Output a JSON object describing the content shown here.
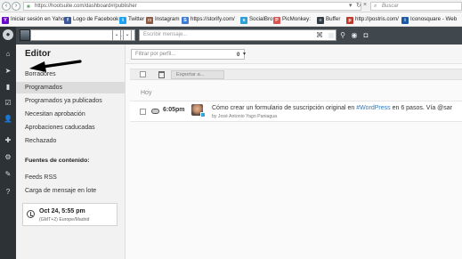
{
  "browser": {
    "url": "https://hootsuite.com/dashboard#/publisher",
    "search_placeholder": "Buscar"
  },
  "bookmarks": [
    {
      "label": "Iniciar sesión en Yahoo",
      "icon": "yahoo-icon",
      "color": "#6b0ac9"
    },
    {
      "label": "Logo de Facebook",
      "icon": "facebook-icon",
      "color": "#3b5998"
    },
    {
      "label": "Twitter",
      "icon": "twitter-icon",
      "color": "#1da1f2"
    },
    {
      "label": "Instagram",
      "icon": "instagram-icon",
      "color": "#8a5a44"
    },
    {
      "label": "https://storify.com/",
      "icon": "storify-icon",
      "color": "#3a7bd5"
    },
    {
      "label": "SocialBro",
      "icon": "socialbro-icon",
      "color": "#2f9fd8"
    },
    {
      "label": "PicMonkey:",
      "icon": "picmonkey-icon",
      "color": "#d9534f"
    },
    {
      "label": "Buffer",
      "icon": "buffer-icon",
      "color": "#323b43"
    },
    {
      "label": "http://postris.com/",
      "icon": "postris-icon",
      "color": "#c0392b"
    },
    {
      "label": "Iconosquare - Web",
      "icon": "iconosquare-icon",
      "color": "#1f5aa6"
    }
  ],
  "topbar": {
    "profile_count": "1",
    "compose_placeholder": "Escribir mensaje..."
  },
  "panel": {
    "title": "Editor",
    "items": [
      {
        "label": "Borradores",
        "active": false
      },
      {
        "label": "Programados",
        "active": true
      },
      {
        "label": "Programados ya publicados",
        "active": false
      },
      {
        "label": "Necesitan aprobación",
        "active": false
      },
      {
        "label": "Aprobaciones caducadas",
        "active": false
      },
      {
        "label": "Rechazado",
        "active": false
      }
    ],
    "content_sources_title": "Fuentes de contenido:",
    "sources": [
      "Feeds RSS",
      "Carga de mensaje en lote"
    ],
    "schedule_time": "Oct 24, 5:55 pm",
    "schedule_timezone": "(GMT+2) Europe/Madrid"
  },
  "main": {
    "filter_placeholder": "Filtrar por perfil...",
    "filter_count": "0",
    "export_label": "Exportar a...",
    "day_label": "Hoy",
    "message": {
      "time": "6:05pm",
      "text_before": "Cómo crear un formulario de suscripción original en ",
      "hashtag": "#WordPress",
      "text_after": " en 6 pasos. Vía @sar",
      "author": "by José Antonio Yago Paniagua"
    }
  },
  "colors": {
    "rail": "#2d3236",
    "topbar": "#40474d",
    "link": "#2d7dc4"
  }
}
